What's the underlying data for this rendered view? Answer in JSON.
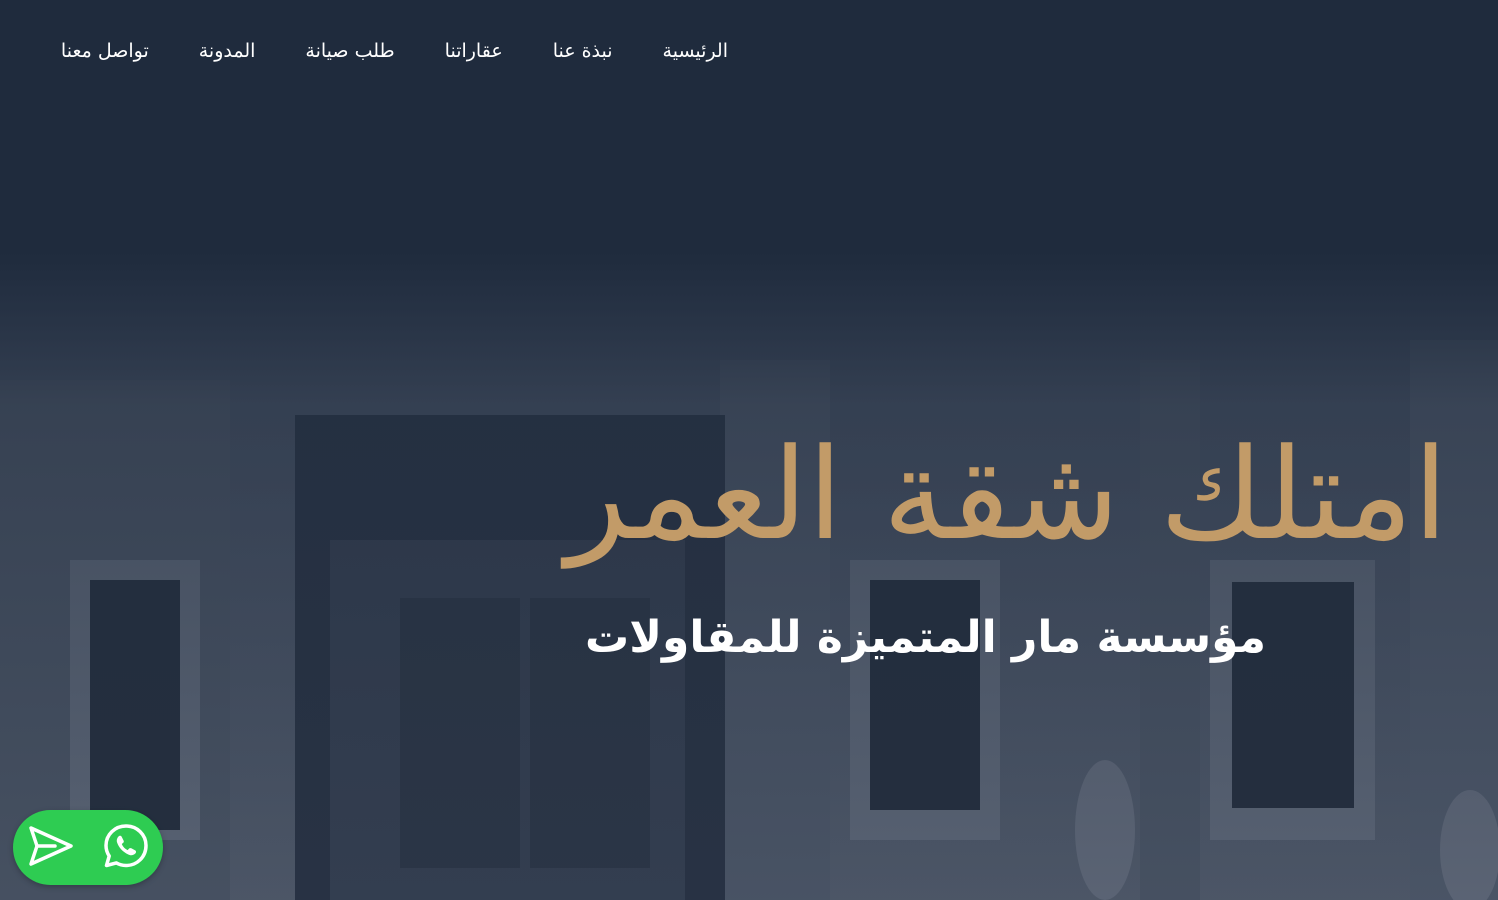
{
  "nav": {
    "items": [
      {
        "label": "الرئيسية"
      },
      {
        "label": "نبذة عنا"
      },
      {
        "label": "عقاراتنا"
      },
      {
        "label": "طلب صيانة"
      },
      {
        "label": "المدونة"
      },
      {
        "label": "تواصل معنا"
      }
    ]
  },
  "hero": {
    "title": "امتلك شقة العمر",
    "subtitle": "مؤسسة مار المتميزة للمقاولات"
  },
  "widget": {
    "send_icon": "send-icon",
    "whatsapp_icon": "whatsapp-icon"
  },
  "colors": {
    "background": "#1f2b3d",
    "accent_gold": "#c29b68",
    "widget_green": "#2ecc52"
  }
}
